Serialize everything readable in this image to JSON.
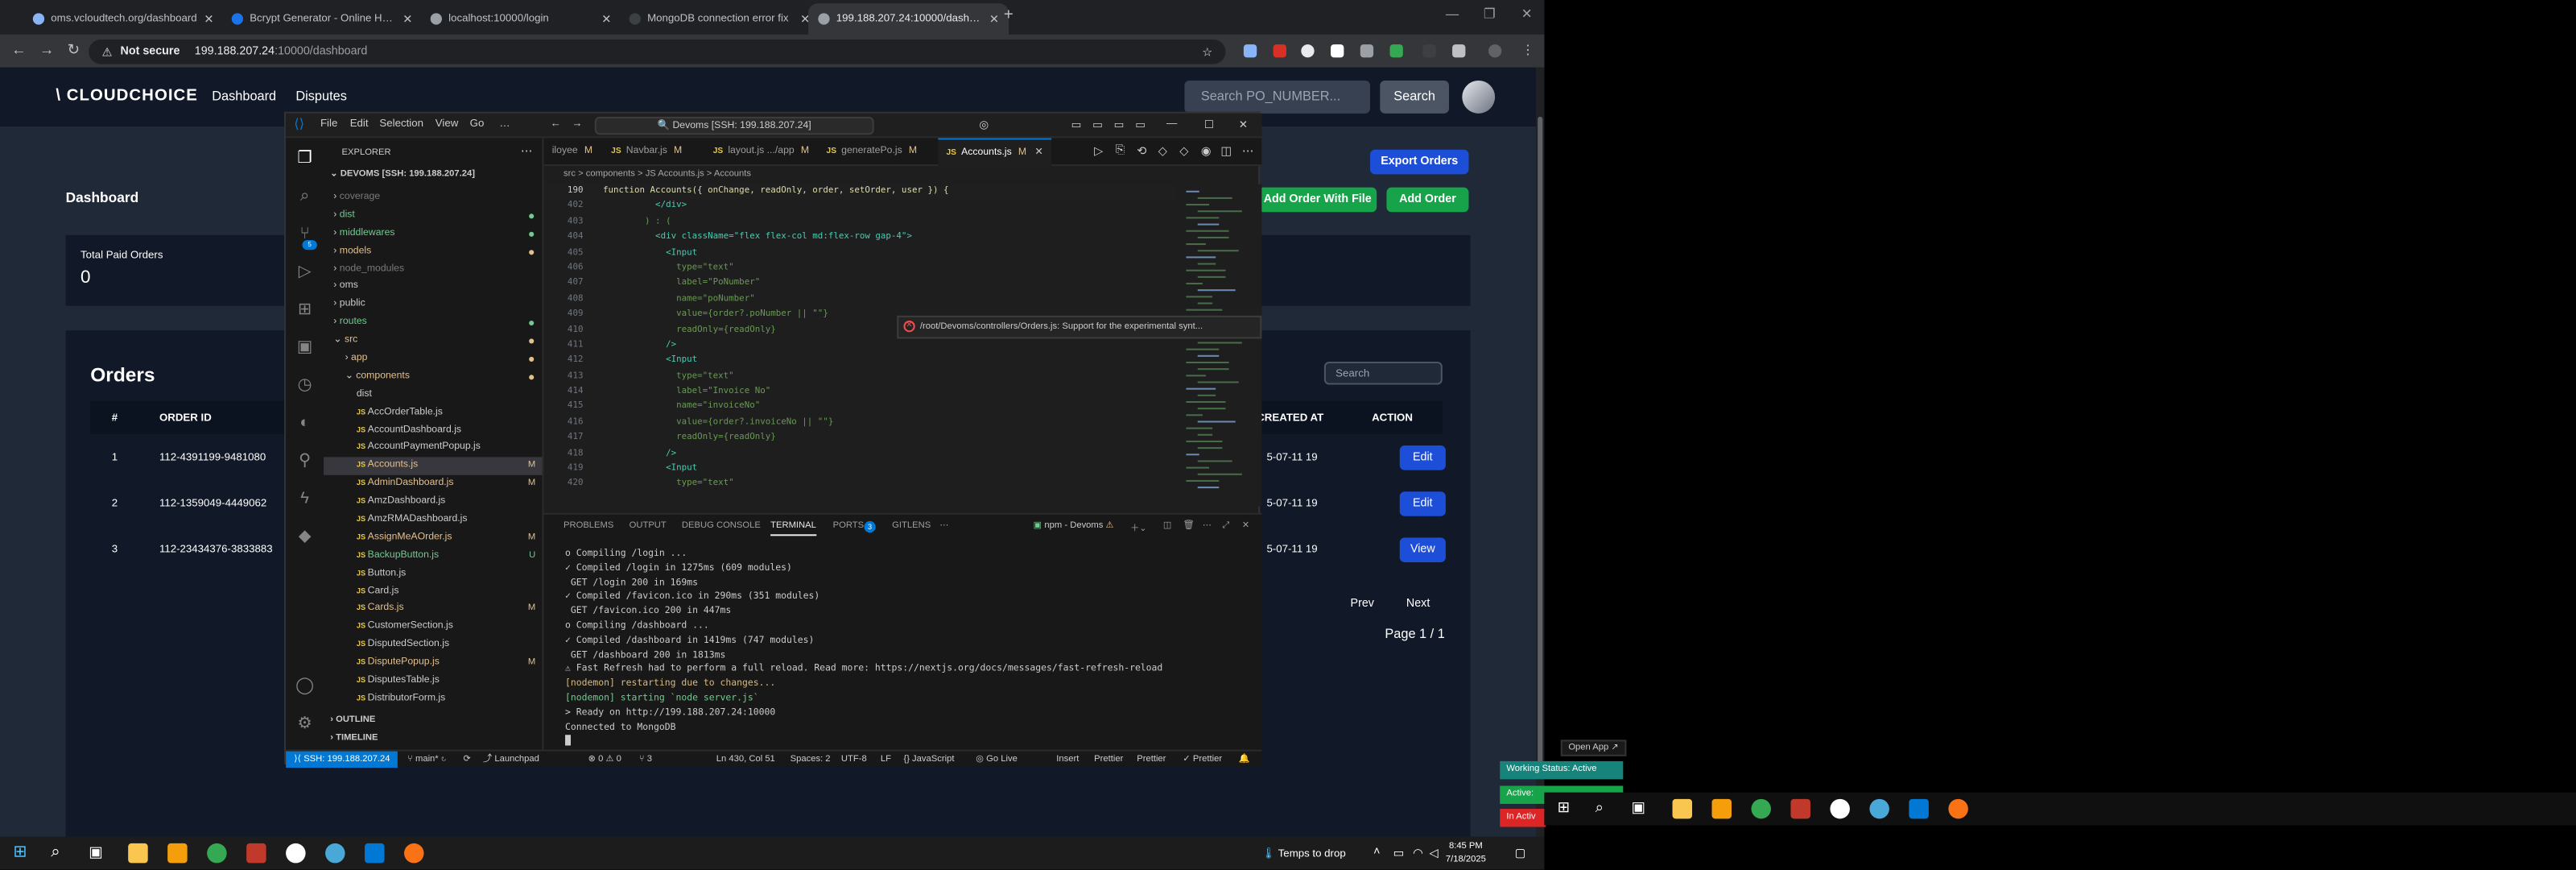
{
  "browser": {
    "tabs": [
      {
        "label": "oms.vcloudtech.org/dashboard",
        "active": false
      },
      {
        "label": "Bcrypt Generator - Online Hash",
        "active": false
      },
      {
        "label": "localhost:10000/login",
        "active": false
      },
      {
        "label": "MongoDB connection error fix",
        "active": false
      },
      {
        "label": "199.188.207.24:10000/dashboard",
        "active": true
      }
    ],
    "security_label": "Not secure",
    "url_host": "199.188.207.24",
    "url_path": ":10000/dashboard"
  },
  "app": {
    "logo": "\\ CLOUDCHOICE",
    "nav": [
      "Dashboard",
      "Disputes"
    ],
    "search_placeholder": "Search PO_NUMBER...",
    "search_button": "Search",
    "page_title": "Dashboard",
    "export_button": "Export Orders",
    "add_file_button": "Add Order With File",
    "add_order_button": "Add Order",
    "stat_label": "Total Paid Orders",
    "stat_value": "0",
    "orders_title": "Orders",
    "table_search_placeholder": "Search",
    "columns": {
      "num": "#",
      "order_id": "ORDER ID",
      "created": "CREATED AT",
      "action": "ACTION"
    },
    "rows": [
      {
        "num": "1",
        "order_id": "112-4391199-9481080",
        "created": "5-07-11 19",
        "action": "Edit"
      },
      {
        "num": "2",
        "order_id": "112-1359049-4449062",
        "created": "5-07-11 19",
        "action": "Edit"
      },
      {
        "num": "3",
        "order_id": "112-23434376-3833883",
        "created": "5-07-11 19",
        "action": "View"
      }
    ],
    "prev": "Prev",
    "next": "Next",
    "page_info": "Page 1 / 1"
  },
  "vscode": {
    "menu": [
      "File",
      "Edit",
      "Selection",
      "View",
      "Go",
      "…"
    ],
    "command_center": "Devoms [SSH: 199.188.207.24]",
    "explorer_title": "EXPLORER",
    "root": "DEVOMS [SSH: 199.188.207.24]",
    "files": [
      {
        "name": "coverage",
        "type": "folder",
        "depth": 1,
        "color": "#7a7a7a",
        "mark": ""
      },
      {
        "name": "dist",
        "type": "folder",
        "depth": 1,
        "color": "#73c991",
        "mark": "dot"
      },
      {
        "name": "middlewares",
        "type": "folder",
        "depth": 1,
        "color": "#73c991",
        "mark": "dot"
      },
      {
        "name": "models",
        "type": "folder",
        "depth": 1,
        "color": "#e2c08d",
        "mark": "dot"
      },
      {
        "name": "node_modules",
        "type": "folder",
        "depth": 1,
        "color": "#7a7a7a",
        "mark": ""
      },
      {
        "name": "oms",
        "type": "folder",
        "depth": 1,
        "color": "#cccccc",
        "mark": ""
      },
      {
        "name": "public",
        "type": "folder",
        "depth": 1,
        "color": "#cccccc",
        "mark": ""
      },
      {
        "name": "routes",
        "type": "folder",
        "depth": 1,
        "color": "#73c991",
        "mark": "dot"
      },
      {
        "name": "src",
        "type": "folder-open",
        "depth": 1,
        "color": "#e2c08d",
        "mark": "dot"
      },
      {
        "name": "app",
        "type": "folder",
        "depth": 2,
        "color": "#e2c08d",
        "mark": "dot"
      },
      {
        "name": "components",
        "type": "folder-open",
        "depth": 2,
        "color": "#e2c08d",
        "mark": "dot"
      },
      {
        "name": "dist",
        "type": "file",
        "depth": 3,
        "color": "#cccccc",
        "mark": ""
      },
      {
        "name": "AccOrderTable.js",
        "type": "file",
        "depth": 3,
        "color": "#cccccc",
        "mark": ""
      },
      {
        "name": "AccountDashboard.js",
        "type": "file",
        "depth": 3,
        "color": "#cccccc",
        "mark": ""
      },
      {
        "name": "AccountPaymentPopup.js",
        "type": "file",
        "depth": 3,
        "color": "#cccccc",
        "mark": ""
      },
      {
        "name": "Accounts.js",
        "type": "file",
        "depth": 3,
        "color": "#e2c08d",
        "mark": "M",
        "selected": true
      },
      {
        "name": "AdminDashboard.js",
        "type": "file",
        "depth": 3,
        "color": "#e2c08d",
        "mark": "M"
      },
      {
        "name": "AmzDashboard.js",
        "type": "file",
        "depth": 3,
        "color": "#cccccc",
        "mark": ""
      },
      {
        "name": "AmzRMADashboard.js",
        "type": "file",
        "depth": 3,
        "color": "#cccccc",
        "mark": ""
      },
      {
        "name": "AssignMeAOrder.js",
        "type": "file",
        "depth": 3,
        "color": "#e2c08d",
        "mark": "M"
      },
      {
        "name": "BackupButton.js",
        "type": "file",
        "depth": 3,
        "color": "#73c991",
        "mark": "U"
      },
      {
        "name": "Button.js",
        "type": "file",
        "depth": 3,
        "color": "#cccccc",
        "mark": ""
      },
      {
        "name": "Card.js",
        "type": "file",
        "depth": 3,
        "color": "#cccccc",
        "mark": ""
      },
      {
        "name": "Cards.js",
        "type": "file",
        "depth": 3,
        "color": "#e2c08d",
        "mark": "M"
      },
      {
        "name": "CustomerSection.js",
        "type": "file",
        "depth": 3,
        "color": "#cccccc",
        "mark": ""
      },
      {
        "name": "DisputedSection.js",
        "type": "file",
        "depth": 3,
        "color": "#cccccc",
        "mark": ""
      },
      {
        "name": "DisputePopup.js",
        "type": "file",
        "depth": 3,
        "color": "#e2c08d",
        "mark": "M"
      },
      {
        "name": "DisputesTable.js",
        "type": "file",
        "depth": 3,
        "color": "#cccccc",
        "mark": ""
      },
      {
        "name": "DistributorForm.js",
        "type": "file",
        "depth": 3,
        "color": "#cccccc",
        "mark": ""
      }
    ],
    "outline": "OUTLINE",
    "timeline": "TIMELINE",
    "editor_tabs": [
      {
        "label": "iloyee",
        "mod": "M",
        "active": false
      },
      {
        "label": "Navbar.js",
        "mod": "M",
        "active": false
      },
      {
        "label": "layout.js  .../app",
        "mod": "M",
        "active": false
      },
      {
        "label": "generatePo.js",
        "mod": "M",
        "active": false
      },
      {
        "label": "Accounts.js",
        "mod": "M",
        "active": true
      }
    ],
    "breadcrumbs": "src > components > JS Accounts.js > Accounts",
    "code_lines": [
      {
        "n": "190",
        "t": "function Accounts({ onChange, readOnly, order, setOrder, user }) {"
      },
      {
        "n": "402",
        "t": "          </div>"
      },
      {
        "n": "403",
        "t": "        ) : ("
      },
      {
        "n": "404",
        "t": "          <div className=\"flex flex-col md:flex-row gap-4\">"
      },
      {
        "n": "405",
        "t": "            <Input"
      },
      {
        "n": "406",
        "t": "              type=\"text\""
      },
      {
        "n": "407",
        "t": "              label=\"PoNumber\""
      },
      {
        "n": "408",
        "t": "              name=\"poNumber\""
      },
      {
        "n": "409",
        "t": "              value={order?.poNumber || \"\"}"
      },
      {
        "n": "410",
        "t": "              readOnly={readOnly}"
      },
      {
        "n": "411",
        "t": "            />"
      },
      {
        "n": "412",
        "t": "            <Input"
      },
      {
        "n": "413",
        "t": "              type=\"text\""
      },
      {
        "n": "414",
        "t": "              label=\"Invoice No\""
      },
      {
        "n": "415",
        "t": "              name=\"invoiceNo\""
      },
      {
        "n": "416",
        "t": "              value={order?.invoiceNo || \"\"}"
      },
      {
        "n": "417",
        "t": "              readOnly={readOnly}"
      },
      {
        "n": "418",
        "t": "            />"
      },
      {
        "n": "419",
        "t": "            <Input"
      },
      {
        "n": "420",
        "t": "              type=\"text\""
      }
    ],
    "panel_tabs": [
      "PROBLEMS",
      "OUTPUT",
      "DEBUG CONSOLE",
      "TERMINAL",
      "PORTS",
      "GITLENS"
    ],
    "ports_count": "3",
    "terminal_name": "npm - Devoms",
    "terminal_lines": [
      {
        "t": "o Compiling /login ...",
        "c": "#cccccc"
      },
      {
        "t": "✓ Compiled /login in 1275ms (609 modules)",
        "c": "#cccccc"
      },
      {
        "t": " GET /login 200 in 169ms",
        "c": "#cccccc"
      },
      {
        "t": "✓ Compiled /favicon.ico in 290ms (351 modules)",
        "c": "#cccccc"
      },
      {
        "t": " GET /favicon.ico 200 in 447ms",
        "c": "#cccccc"
      },
      {
        "t": "o Compiling /dashboard ...",
        "c": "#cccccc"
      },
      {
        "t": "✓ Compiled /dashboard in 1419ms (747 modules)",
        "c": "#cccccc"
      },
      {
        "t": " GET /dashboard 200 in 1813ms",
        "c": "#cccccc"
      },
      {
        "t": "⚠ Fast Refresh had to perform a full reload. Read more: https://nextjs.org/docs/messages/fast-refresh-reload",
        "c": "#cccccc"
      },
      {
        "t": "[nodemon] restarting due to changes...",
        "c": "#d7ba7d"
      },
      {
        "t": "[nodemon] starting `node server.js`",
        "c": "#73c991"
      },
      {
        "t": "> Ready on http://199.188.207.24:10000",
        "c": "#cccccc"
      },
      {
        "t": "Connected to MongoDB",
        "c": "#cccccc"
      },
      {
        "t": "█",
        "c": "#cccccc"
      }
    ],
    "toast": "/root/Devoms/controllers/Orders.js: Support for the experimental synt...",
    "status": {
      "remote": "SSH: 199.188.207.24",
      "branch": "main*",
      "launchpad": "Launchpad",
      "problems": "⊗ 0 ⚠ 0",
      "ports": "⑂ 3",
      "position": "Ln 430, Col 51",
      "spaces": "Spaces: 2",
      "encoding": "UTF-8",
      "eol": "LF",
      "language": "{} JavaScript",
      "golive": "Go Live",
      "insert": "Insert",
      "prettier1": "Prettier",
      "prettier2": "Prettier",
      "prettier3": "✓ Prettier"
    }
  },
  "overlay": {
    "open_app": "Open App ↗",
    "working_status": "Working Status: Active",
    "active": "Active:",
    "inactive": "In Activ"
  },
  "taskbar": {
    "drop_text": "Temps to drop",
    "time": "8:45 PM",
    "date": "7/18/2025"
  }
}
